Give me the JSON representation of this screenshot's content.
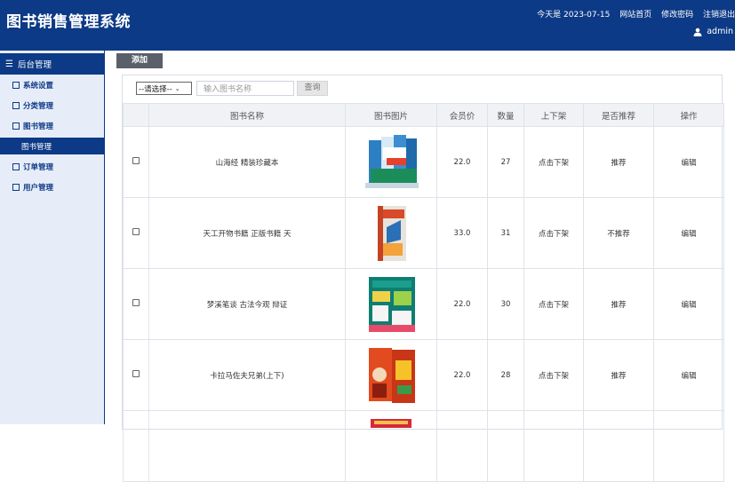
{
  "app": {
    "title": "图书销售管理系统"
  },
  "header": {
    "date_text": "今天是 2023-07-15",
    "links": [
      "网站首页",
      "修改密码",
      "注销退出"
    ],
    "user": "admin"
  },
  "sidebar": {
    "title": "后台管理",
    "items": [
      {
        "label": "系统设置"
      },
      {
        "label": "分类管理"
      },
      {
        "label": "图书管理"
      },
      {
        "label": "图书管理"
      },
      {
        "label": "订单管理"
      },
      {
        "label": "用户管理"
      }
    ]
  },
  "toolbar": {
    "add_label": "添加"
  },
  "search": {
    "select_value": "--请选择--",
    "placeholder": "输入图书名称",
    "button_label": "查询"
  },
  "table": {
    "headers": [
      "图书名称",
      "图书图片",
      "会员价",
      "数量",
      "上下架",
      "是否推荐",
      "操作"
    ],
    "rows": [
      {
        "name": "山海经 精装珍藏本",
        "price": "22.0",
        "qty": "27",
        "shelf": "点击下架",
        "recommend": "推荐",
        "action": "编辑"
      },
      {
        "name": "天工开物书籍 正版书籍 天",
        "price": "33.0",
        "qty": "31",
        "shelf": "点击下架",
        "recommend": "不推荐",
        "action": "编辑"
      },
      {
        "name": "梦溪笔谈 古法今观 辩证",
        "price": "22.0",
        "qty": "30",
        "shelf": "点击下架",
        "recommend": "推荐",
        "action": "编辑"
      },
      {
        "name": "卡拉马佐夫兄弟(上下)",
        "price": "22.0",
        "qty": "28",
        "shelf": "点击下架",
        "recommend": "推荐",
        "action": "编辑"
      }
    ]
  },
  "colors": {
    "primary": "#0d3a86",
    "sidebar_bg": "#e7edf8",
    "button_gray": "#5a6069"
  }
}
